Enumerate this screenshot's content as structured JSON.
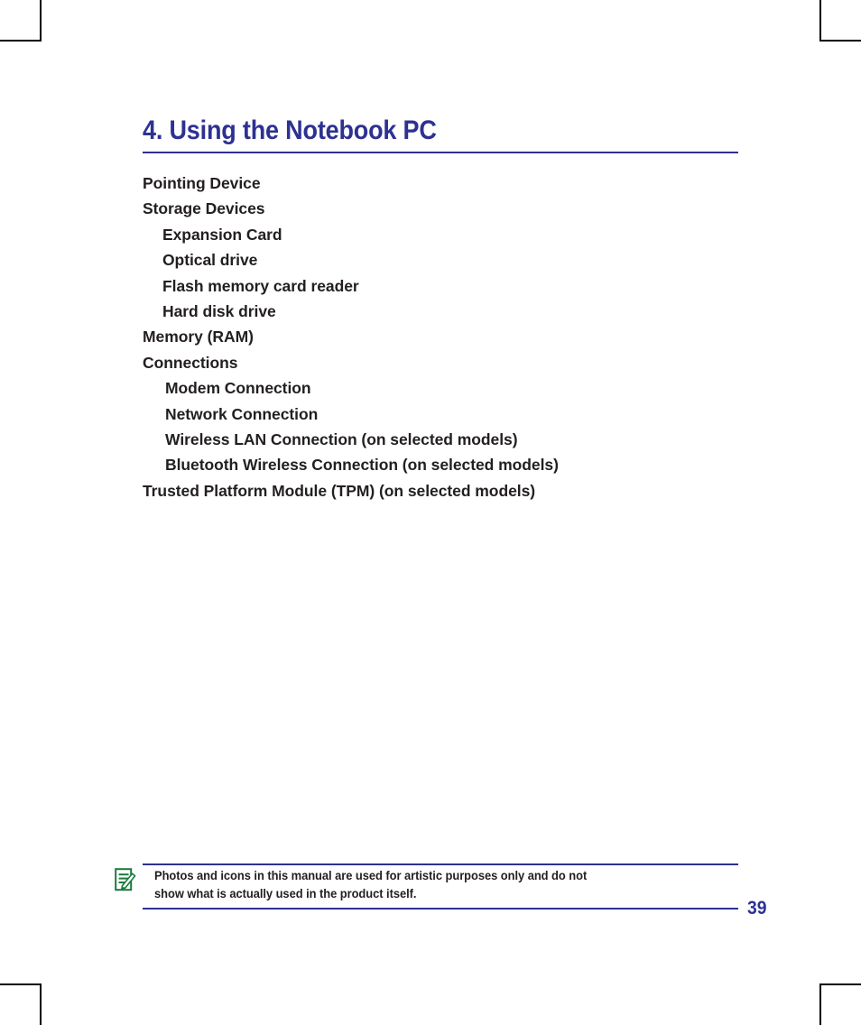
{
  "document": {
    "chapter_title": "4. Using the Notebook PC",
    "page_number": "39",
    "accent_color": "#2e3192",
    "text_color": "#231f20",
    "note_icon_color": "#1a7a3c"
  },
  "toc": {
    "items": [
      {
        "label": "Pointing Device",
        "level": 1
      },
      {
        "label": "Storage Devices",
        "level": 1
      },
      {
        "label": "Expansion Card",
        "level": 2
      },
      {
        "label": "Optical drive",
        "level": 2
      },
      {
        "label": "Flash memory card reader",
        "level": 2
      },
      {
        "label": "Hard disk drive",
        "level": 2
      },
      {
        "label": "Memory (RAM)",
        "level": 1
      },
      {
        "label": "Connections",
        "level": 1
      },
      {
        "label": "Modem Connection",
        "level": 2
      },
      {
        "label": "Network Connection",
        "level": 2
      },
      {
        "label": "Wireless LAN Connection (on selected models)",
        "level": 2
      },
      {
        "label": "Bluetooth Wireless Connection (on selected models)",
        "level": 2
      },
      {
        "label": "Trusted Platform Module (TPM) (on selected models)",
        "level": 1
      }
    ]
  },
  "note": {
    "icon_name": "note-pencil-icon",
    "line1": "Photos and icons in this manual are used for artistic purposes only and do not",
    "line2": "show what is actually used in the product itself."
  }
}
